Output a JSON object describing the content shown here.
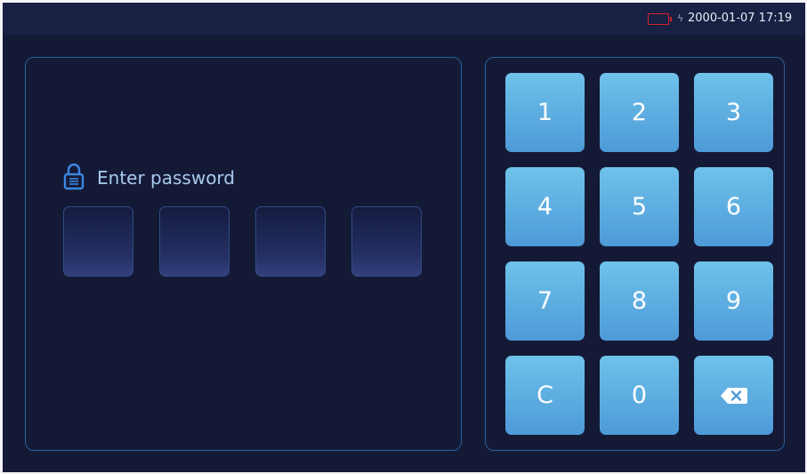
{
  "status_bar": {
    "battery_color": "#d2232a",
    "charge_symbol": "ϟ",
    "datetime": "2000-01-07 17:19"
  },
  "password": {
    "icon": "lock-icon",
    "prompt": "Enter password",
    "slot_count": 4,
    "entered_digits": 0
  },
  "keypad": {
    "keys": [
      "1",
      "2",
      "3",
      "4",
      "5",
      "6",
      "7",
      "8",
      "9",
      "C",
      "0"
    ],
    "backspace_icon": "backspace-icon"
  },
  "colors": {
    "background": "#141a36",
    "panel_border": "#2c5e9b",
    "key_top": "#6ec2ea",
    "key_bottom": "#4e9ad8",
    "prompt_text": "#a9c9ee"
  }
}
